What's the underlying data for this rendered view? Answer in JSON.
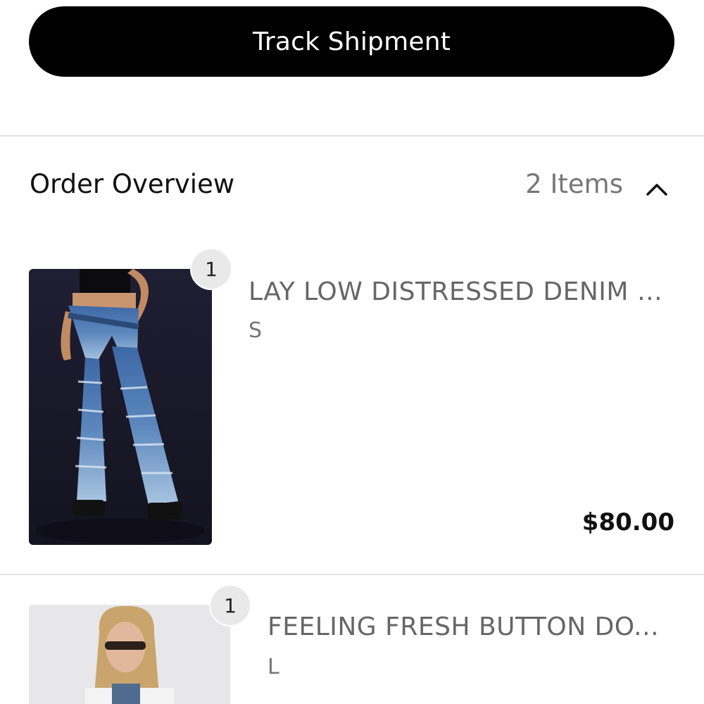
{
  "actions": {
    "track_label": "Track Shipment"
  },
  "overview": {
    "title": "Order Overview",
    "count_label": "2 Items",
    "toggle_icon": "chevron-up-icon"
  },
  "products": [
    {
      "quantity": "1",
      "name": "LAY LOW DISTRESSED DENIM F...",
      "size": "S",
      "price": "$80.00"
    },
    {
      "quantity": "1",
      "name": "FEELING FRESH BUTTON DO...",
      "size": "L"
    }
  ],
  "colors": {
    "button_bg": "#000000",
    "background": "#ffffff",
    "muted_text": "#777777"
  }
}
